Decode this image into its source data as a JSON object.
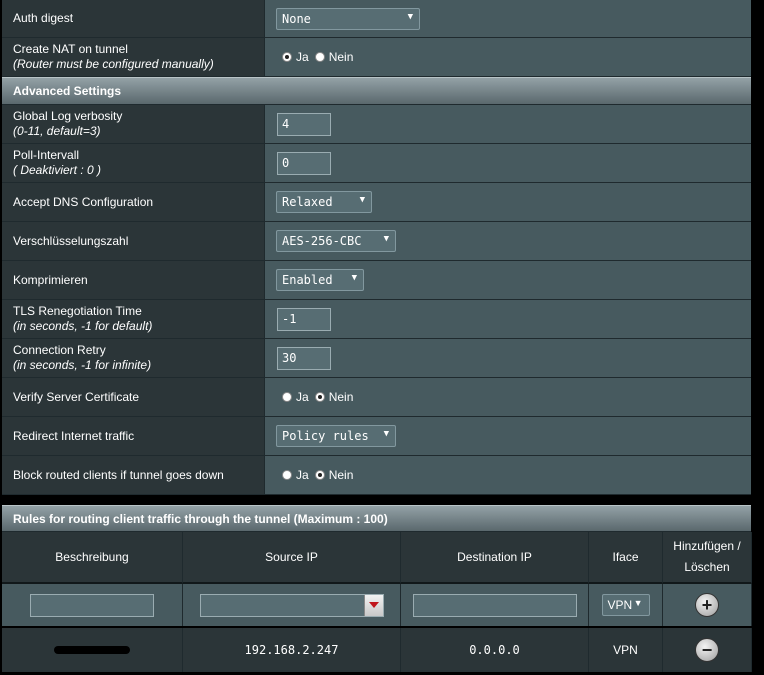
{
  "rows_top": [
    {
      "label": "Auth digest",
      "sub": "",
      "type": "select",
      "value": "None"
    },
    {
      "label": "Create NAT on tunnel",
      "sub": "(Router must be configured manually)",
      "type": "radio",
      "yes": "Ja",
      "no": "Nein",
      "selected": "yes"
    }
  ],
  "section_advanced": "Advanced Settings",
  "rows_adv": [
    {
      "label": "Global Log verbosity",
      "sub": "(0-11, default=3)",
      "type": "text",
      "value": "4"
    },
    {
      "label": "Poll-Intervall",
      "sub": "( Deaktiviert : 0 )",
      "type": "text",
      "value": "0"
    },
    {
      "label": "Accept DNS Configuration",
      "sub": "",
      "type": "select",
      "value": "Relaxed"
    },
    {
      "label": "Verschlüsselungszahl",
      "sub": "",
      "type": "select",
      "value": "AES-256-CBC"
    },
    {
      "label": "Komprimieren",
      "sub": "",
      "type": "select",
      "value": "Enabled"
    },
    {
      "label": "TLS Renegotiation Time",
      "sub": "(in seconds, -1 for default)",
      "type": "text",
      "value": "-1"
    },
    {
      "label": "Connection Retry",
      "sub": "(in seconds, -1 for infinite)",
      "type": "text",
      "value": "30"
    },
    {
      "label": "Verify Server Certificate",
      "sub": "",
      "type": "radio",
      "yes": "Ja",
      "no": "Nein",
      "selected": "no"
    },
    {
      "label": "Redirect Internet traffic",
      "sub": "",
      "type": "select",
      "value": "Policy rules"
    },
    {
      "label": "Block routed clients if tunnel goes down",
      "sub": "",
      "type": "radio",
      "yes": "Ja",
      "no": "Nein",
      "selected": "no"
    }
  ],
  "rules": {
    "title": "Rules for routing client traffic through the tunnel (Maximum : 100)",
    "headers": {
      "desc": "Beschreibung",
      "src": "Source IP",
      "dst": "Destination IP",
      "iface": "Iface",
      "action": "Hinzufügen / Löschen"
    },
    "new_iface": "VPN",
    "entries": [
      {
        "src": "192.168.2.247",
        "dst": "0.0.0.0",
        "iface": "VPN"
      }
    ]
  },
  "icons": {
    "add": "plus-circle-icon",
    "remove": "minus-circle-icon",
    "dropdown": "chevron-down-icon"
  }
}
